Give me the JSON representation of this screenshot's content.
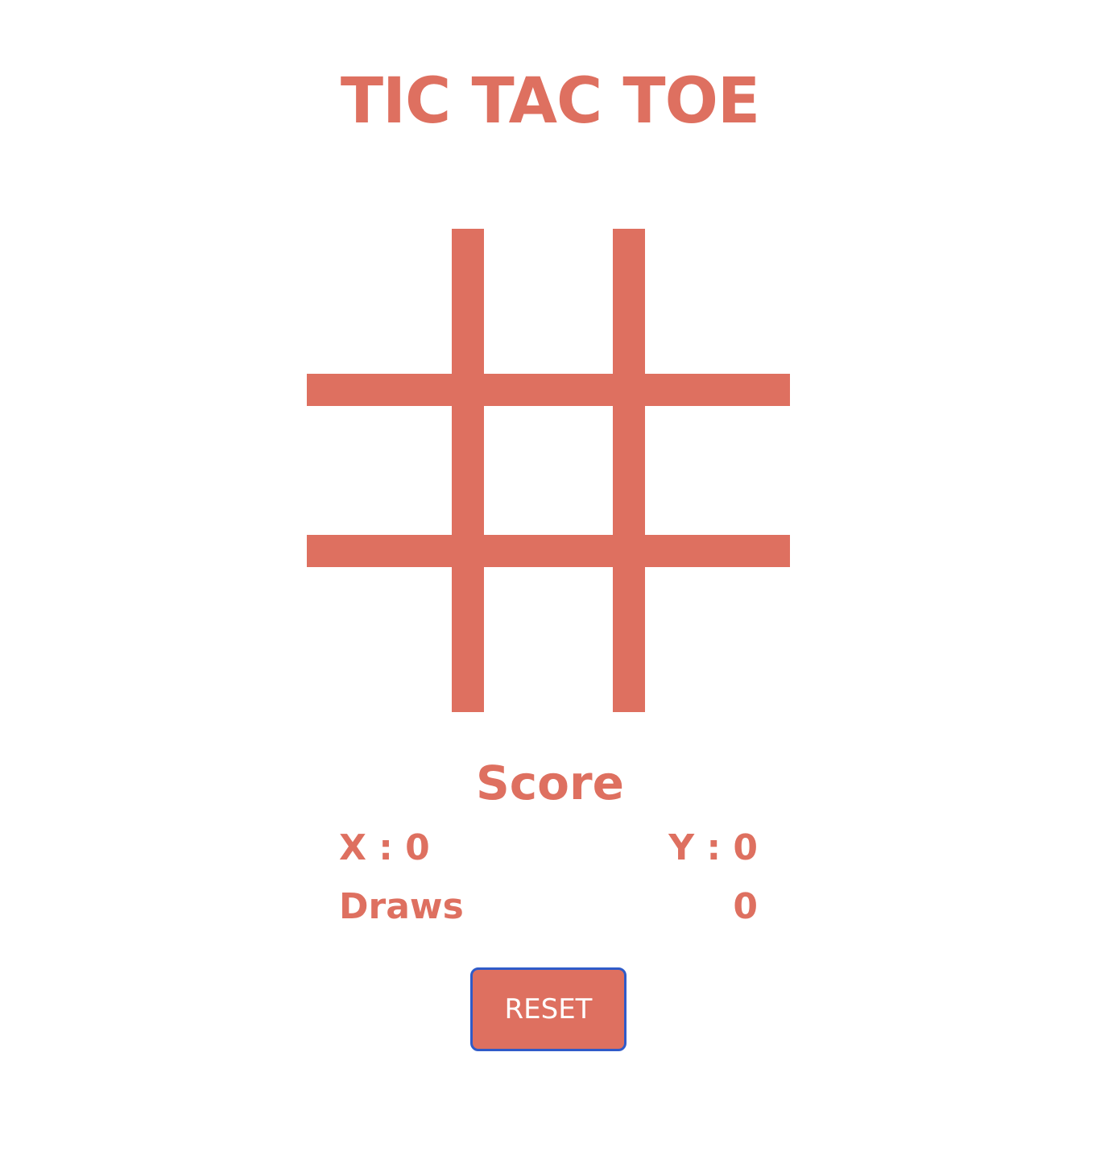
{
  "title": "TIC TAC TOE",
  "board": {
    "cells": [
      "",
      "",
      "",
      "",
      "",
      "",
      "",
      "",
      ""
    ]
  },
  "score": {
    "heading": "Score",
    "x_label": "X : 0",
    "y_label": "Y : 0",
    "draws_label": "Draws",
    "draws_value": "0"
  },
  "reset_label": "RESET",
  "colors": {
    "accent": "#de7060",
    "button_border": "#2f5bc9",
    "background": "#ffffff"
  }
}
